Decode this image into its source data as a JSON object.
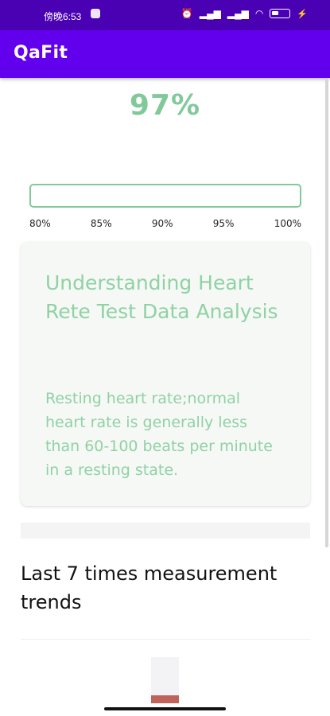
{
  "status_bar": {
    "time": "傍晚6:53",
    "icons": [
      "app-notification-icon",
      "alarm-icon",
      "cell-signal-icon",
      "cell-signal-icon",
      "wifi-icon",
      "battery-icon",
      "charging-icon"
    ]
  },
  "app_bar": {
    "title": "QaFit"
  },
  "reading": {
    "percent_label": "97%",
    "progress_fraction": 0.0
  },
  "scale": {
    "ticks": [
      "80%",
      "85%",
      "90%",
      "95%",
      "100%"
    ]
  },
  "info_card": {
    "title": "Understanding Heart Rete Test Data Analysis",
    "body": "Resting heart rate;normal heart rate is generally less than 60-100 beats per minute in a resting state."
  },
  "trends": {
    "title": "Last 7 times measurement trends",
    "bar_fraction": 0.17
  },
  "colors": {
    "status_bar": "#4a00b3",
    "app_bar": "#6200ee",
    "accent_green": "#82c99a",
    "trend_bar": "#c0635a"
  }
}
